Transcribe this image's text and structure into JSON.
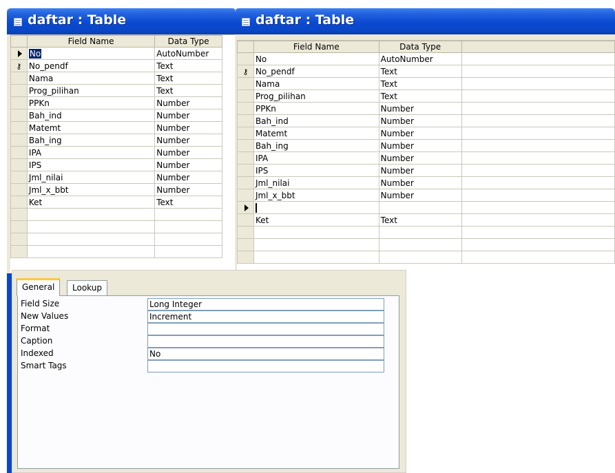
{
  "window_left": {
    "title": "daftar : Table",
    "headers": {
      "field": "Field Name",
      "type": "Data Type"
    },
    "rows": [
      {
        "field": "No",
        "type": "AutoNumber",
        "marker": "arrow",
        "highlight": true
      },
      {
        "field": "No_pendf",
        "type": "Text",
        "marker": "key"
      },
      {
        "field": "Nama",
        "type": "Text"
      },
      {
        "field": "Prog_pilihan",
        "type": "Text"
      },
      {
        "field": "PPKn",
        "type": "Number"
      },
      {
        "field": "Bah_ind",
        "type": "Number"
      },
      {
        "field": "Matemt",
        "type": "Number"
      },
      {
        "field": "Bah_ing",
        "type": "Number"
      },
      {
        "field": "IPA",
        "type": "Number"
      },
      {
        "field": "IPS",
        "type": "Number"
      },
      {
        "field": "Jml_nilai",
        "type": "Number"
      },
      {
        "field": "Jml_x_bbt",
        "type": "Number"
      },
      {
        "field": "Ket",
        "type": "Text"
      },
      {
        "field": "",
        "type": ""
      },
      {
        "field": "",
        "type": ""
      },
      {
        "field": "",
        "type": ""
      },
      {
        "field": "",
        "type": ""
      }
    ]
  },
  "window_right": {
    "title": "daftar : Table",
    "headers": {
      "field": "Field Name",
      "type": "Data Type"
    },
    "rows": [
      {
        "field": "No",
        "type": "AutoNumber"
      },
      {
        "field": "No_pendf",
        "type": "Text",
        "marker": "key"
      },
      {
        "field": "Nama",
        "type": "Text"
      },
      {
        "field": "Prog_pilihan",
        "type": "Text"
      },
      {
        "field": "PPKn",
        "type": "Number"
      },
      {
        "field": "Bah_ind",
        "type": "Number"
      },
      {
        "field": "Matemt",
        "type": "Number"
      },
      {
        "field": "Bah_ing",
        "type": "Number"
      },
      {
        "field": "IPA",
        "type": "Number"
      },
      {
        "field": "IPS",
        "type": "Number"
      },
      {
        "field": "Jml_nilai",
        "type": "Number"
      },
      {
        "field": "Jml_x_bbt",
        "type": "Number"
      },
      {
        "field": "",
        "type": "",
        "marker": "arrow",
        "editing": true
      },
      {
        "field": "Ket",
        "type": "Text"
      },
      {
        "field": "",
        "type": ""
      },
      {
        "field": "",
        "type": ""
      },
      {
        "field": "",
        "type": ""
      }
    ]
  },
  "properties": {
    "tabs": [
      "General",
      "Lookup"
    ],
    "active_tab": "General",
    "items": [
      {
        "label": "Field Size",
        "value": "Long Integer"
      },
      {
        "label": "New Values",
        "value": "Increment"
      },
      {
        "label": "Format",
        "value": ""
      },
      {
        "label": "Caption",
        "value": ""
      },
      {
        "label": "Indexed",
        "value": "No"
      },
      {
        "label": "Smart Tags",
        "value": ""
      }
    ]
  },
  "colors": {
    "titlebar": "#0a47c6",
    "grid_border": "#c9c7ba",
    "panel": "#ece9d8",
    "selection": "#0a246a"
  }
}
